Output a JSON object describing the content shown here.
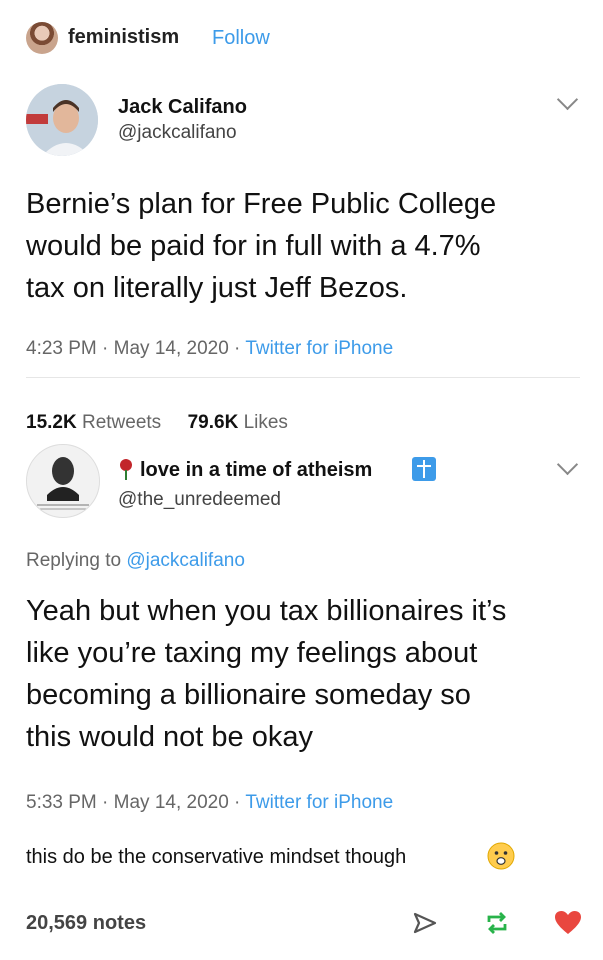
{
  "post": {
    "blog_name": "feministism",
    "follow_label": "Follow"
  },
  "tweet1": {
    "name": "Jack Califano",
    "handle": "@jackcalifano",
    "text_lines": [
      "Bernie’s plan for Free Public College",
      "would be paid for in full with a 4.7%",
      "tax on literally just Jeff Bezos."
    ],
    "time": "4:23 PM · May 14, 2020 · ",
    "source": "Twitter for iPhone",
    "retweets_count": "15.2K",
    "retweets_label": "Retweets",
    "likes_count": "79.6K",
    "likes_label": "Likes"
  },
  "tweet2": {
    "name": "love in a time of atheism",
    "handle": "@the_unredeemed",
    "replying_prefix": "Replying to ",
    "replying_handle": "@jackcalifano",
    "text_lines": [
      "Yeah but when you tax billionaires it’s",
      "like you’re taxing my feelings about",
      "becoming a billionaire someday so",
      "this would not be okay"
    ],
    "time": "5:33 PM · May 14, 2020 · ",
    "source": "Twitter for iPhone"
  },
  "caption": "this do be the conservative mindset though",
  "notes": "20,569 notes",
  "icons": [
    "share-icon",
    "reblog-icon",
    "heart-icon",
    "chevron-down-icon",
    "rose-icon",
    "cross-icon",
    "grimace-emoji-icon"
  ],
  "colors": {
    "link": "#3d9be9",
    "reblog": "#28b34a",
    "heart": "#e9473f"
  }
}
